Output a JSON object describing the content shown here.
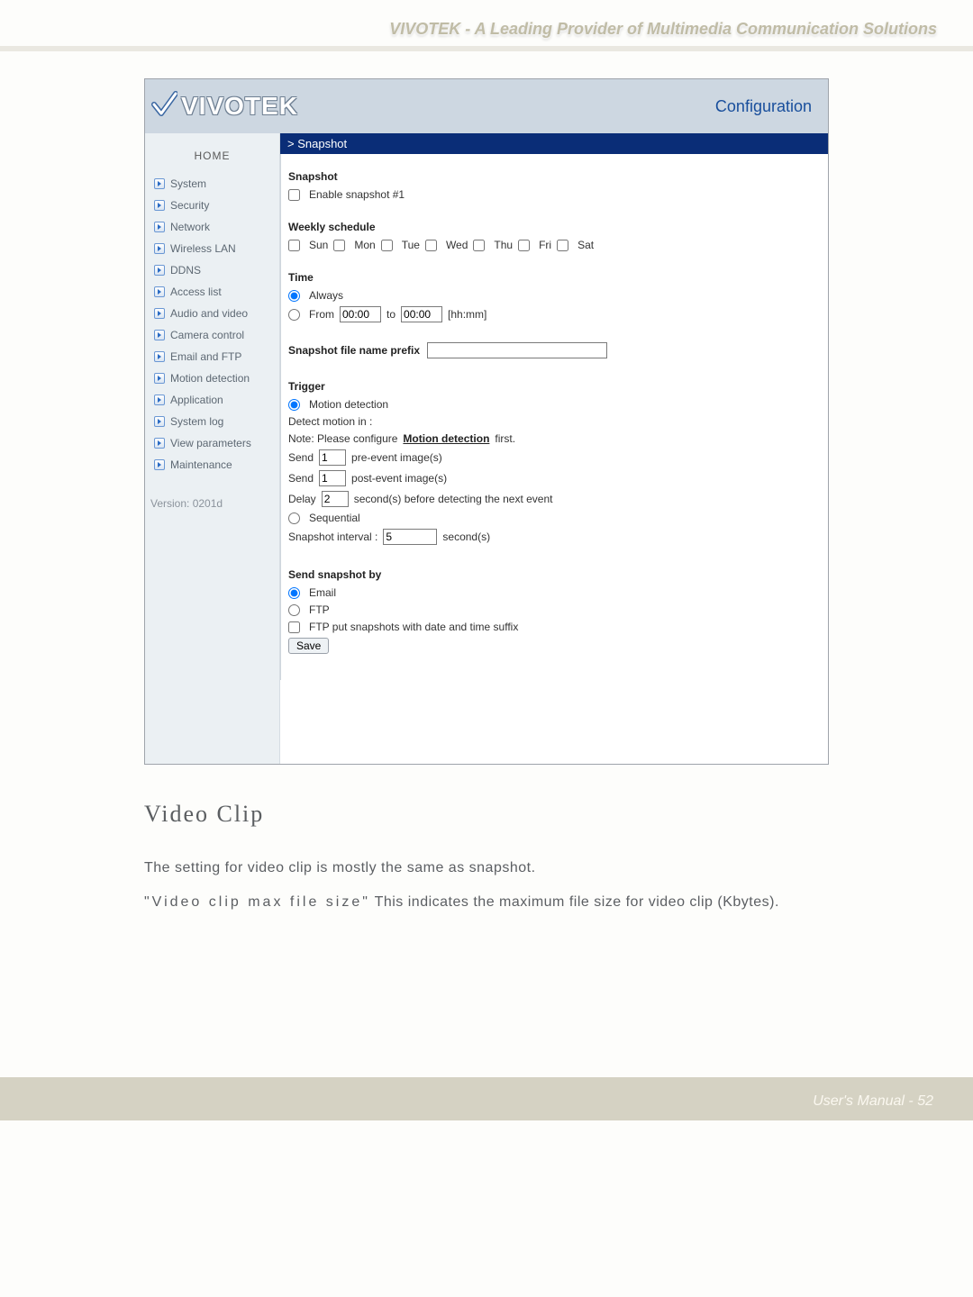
{
  "doc_header_tagline": "VIVOTEK - A Leading Provider of Multimedia Communication Solutions",
  "ss": {
    "brand": "VIVOTEK",
    "config_label": "Configuration",
    "breadcrumb": "> Snapshot",
    "home_label": "HOME",
    "nav": [
      "System",
      "Security",
      "Network",
      "Wireless LAN",
      "DDNS",
      "Access list",
      "Audio and video",
      "Camera control",
      "Email and FTP",
      "Motion detection",
      "Application",
      "System log",
      "View parameters",
      "Maintenance"
    ],
    "version": "Version: 0201d",
    "sections": {
      "snapshot": {
        "title": "Snapshot",
        "enable_label": "Enable snapshot #1"
      },
      "weekly": {
        "title": "Weekly schedule",
        "days": [
          "Sun",
          "Mon",
          "Tue",
          "Wed",
          "Thu",
          "Fri",
          "Sat"
        ]
      },
      "time": {
        "title": "Time",
        "always": "Always",
        "from": "From",
        "from_val": "00:00",
        "to": "to",
        "to_val": "00:00",
        "hint": "[hh:mm]"
      },
      "prefix_label": "Snapshot file name prefix",
      "trigger": {
        "title": "Trigger",
        "motion": "Motion detection",
        "detect_in": "Detect motion in :",
        "note_pre": "Note: Please configure ",
        "note_link": "Motion detection",
        "note_post": " first.",
        "pre_send": "Send",
        "pre_val": "1",
        "pre_suffix": "pre-event image(s)",
        "post_send": "Send",
        "post_val": "1",
        "post_suffix": "post-event image(s)",
        "delay": "Delay",
        "delay_val": "2",
        "delay_suffix": "second(s) before detecting the next event",
        "sequential": "Sequential",
        "interval_label": "Snapshot interval :",
        "interval_val": "5",
        "interval_suffix": "second(s)"
      },
      "send": {
        "title": "Send snapshot by",
        "email": "Email",
        "ftp": "FTP",
        "ftp_suffix": "FTP put snapshots with date and time suffix",
        "save": "Save"
      }
    }
  },
  "doc": {
    "h2": "Video Clip",
    "p1": "The setting for video clip is mostly the same as snapshot.",
    "p2a": "\"Video clip max file size\"",
    "p2b": " This indicates the maximum file size for video clip (Kbytes).",
    "footer": "User's Manual - 52"
  }
}
